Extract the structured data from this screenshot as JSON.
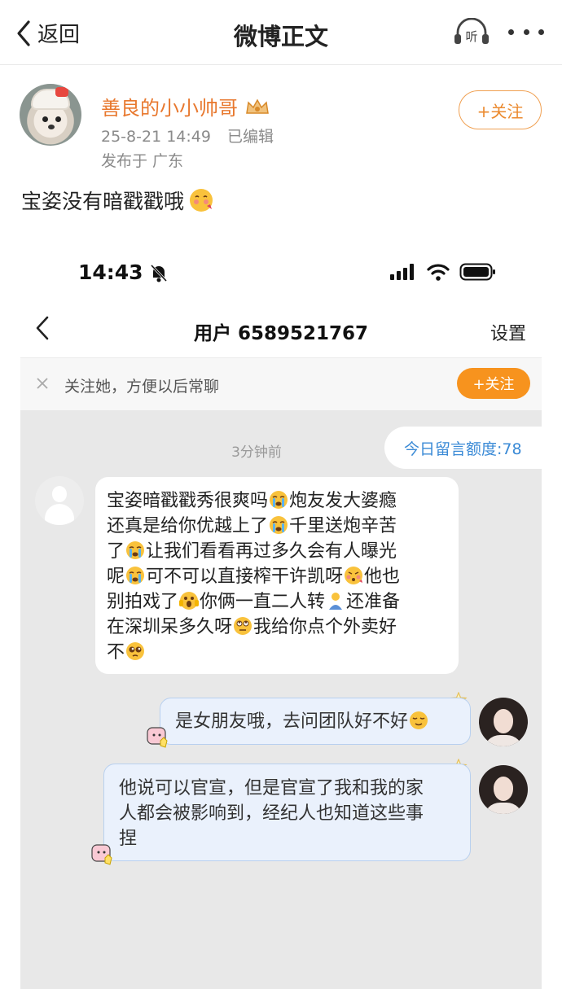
{
  "nav": {
    "back_label": "返回",
    "title": "微博正文",
    "listen_label": "听"
  },
  "post": {
    "author": "善良的小小帅哥",
    "date": "25-8-21 14:49",
    "edited": "已编辑",
    "location": "发布于 广东",
    "follow_label": "+关注",
    "text": "宝姿没有暗戳戳哦"
  },
  "embedded": {
    "status_time": "14:43",
    "chat_title": "用户 6589521767",
    "settings_label": "设置",
    "banner_text": "关注她，方便以后常聊",
    "banner_follow": "+关注",
    "quota": "今日留言额度:78",
    "timestamp": "3分钟前",
    "received_lines": [
      "宝姿暗戳戳秀很爽吗",
      "炮友发大婆瘾",
      "还真是给你优越上了",
      "千里送炮辛苦",
      "了",
      "让我们看看再过多久会有人曝光",
      "呢",
      "可不可以直接榨干许凯呀",
      "他也",
      "别拍戏了",
      "你俩一直二人转",
      "还准备",
      "在深圳呆多久呀",
      "我给你点个外卖好",
      "不"
    ],
    "sent1": "是女朋友哦，去问团队好不好",
    "sent2_lines": [
      "他说可以官宣，但是官宣了我和我的家",
      "人都会被影响到，经纪人也知道这些事",
      "捏"
    ]
  },
  "colors": {
    "accent_orange": "#f7931e",
    "username": "#e8782e",
    "quota_blue": "#3a8ad6",
    "chat_bg": "#e8e8e8",
    "sent_bubble": "#eaf1fc"
  },
  "icons": [
    "back-chevron-icon",
    "headphone-icon",
    "more-icon",
    "vip-crown-icon",
    "bell-mute-icon",
    "signal-icon",
    "wifi-icon",
    "battery-icon",
    "close-icon",
    "cry-emoji",
    "shy-emoji",
    "plead-emoji"
  ]
}
